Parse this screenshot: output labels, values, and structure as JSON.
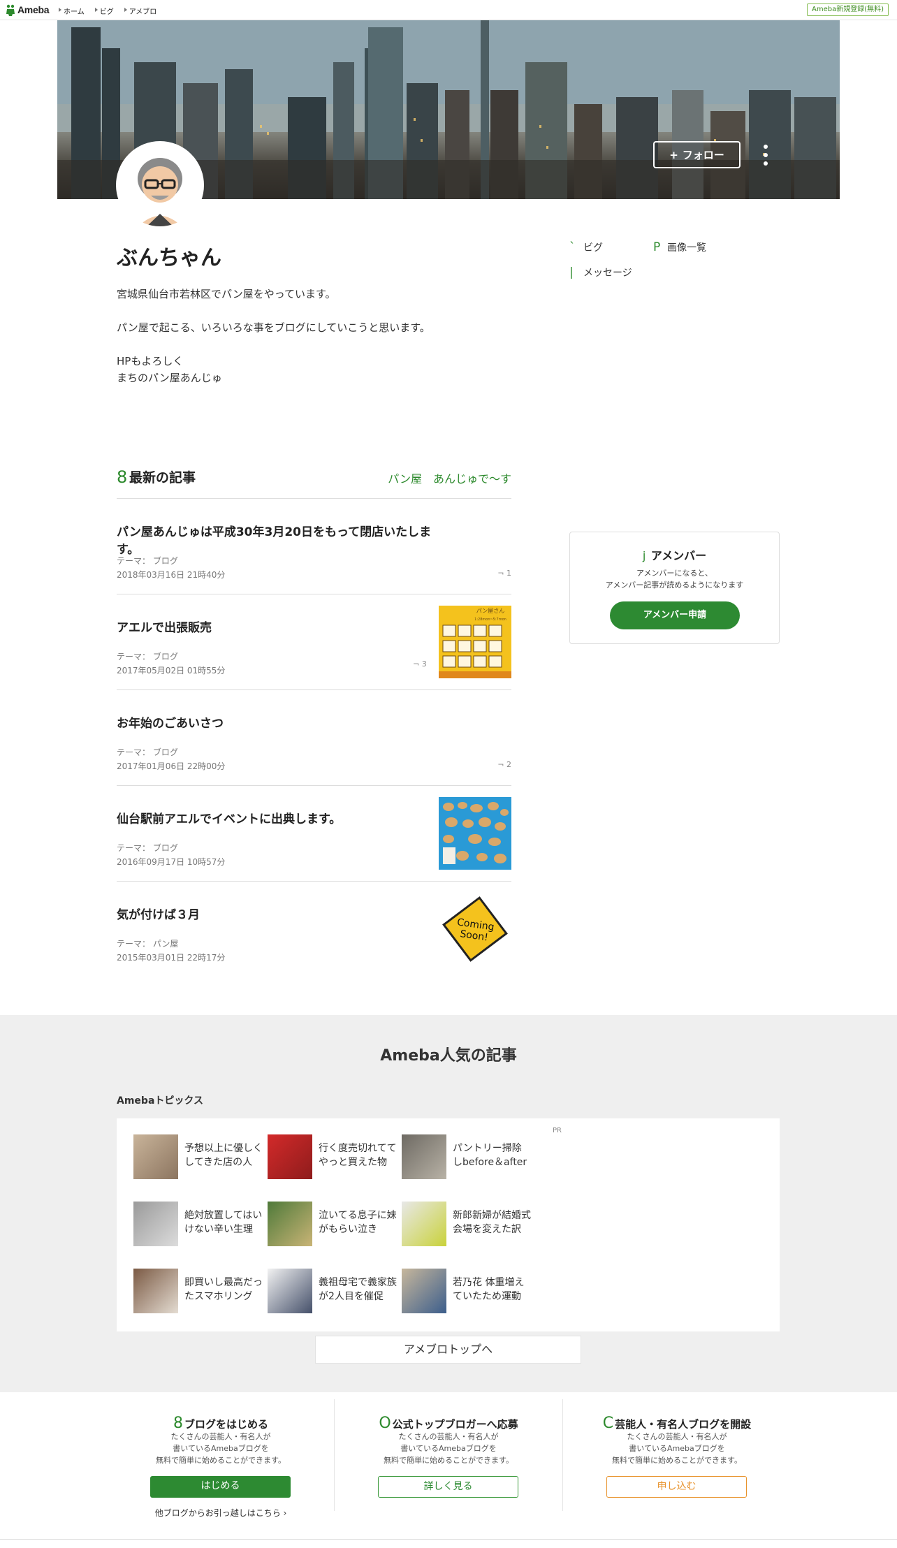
{
  "header": {
    "logo_text": "Ameba",
    "breadcrumbs": [
      "ホーム",
      "ビグ",
      "アメブロ"
    ],
    "register_label": "Ameba新規登録(無料)"
  },
  "profile": {
    "follow_label": "フォロー",
    "name": "ぶんちゃん",
    "bio": "宮城県仙台市若林区でパン屋をやっています。\n\nパン屋で起こる、いろいろな事をブログにしていこうと思います。\n\nHPもよろしく\nまちのパン屋あんじゅ",
    "links": [
      {
        "icon": "`",
        "label": "ビグ"
      },
      {
        "icon": "P",
        "label": "画像一覧"
      },
      {
        "icon": "|",
        "label": "メッセージ"
      }
    ]
  },
  "latest": {
    "icon": "8",
    "heading": "最新の記事",
    "blog_title": "パン屋　あんじゅで〜す",
    "entries": [
      {
        "title": "パン屋あんじゅは平成30年3月20日をもって閉店いたします。",
        "theme": "テーマ： ブログ",
        "date": "2018年03月16日 21時40分",
        "comments": "1"
      },
      {
        "title": "アエルで出張販売",
        "theme": "テーマ： ブログ",
        "date": "2017年05月02日 01時55分",
        "comments": "3"
      },
      {
        "title": "お年始のごあいさつ",
        "theme": "テーマ： ブログ",
        "date": "2017年01月06日 22時00分",
        "comments": "2"
      },
      {
        "title": "仙台駅前アエルでイベントに出典します。",
        "theme": "テーマ： ブログ",
        "date": "2016年09月17日 10時57分",
        "comments": ""
      },
      {
        "title": "気が付けば３月",
        "theme": "テーマ： パン屋",
        "date": "2015年03月01日 22時17分",
        "comments": ""
      }
    ],
    "comment_icon": "¬",
    "thumb2_lines": [
      "パン屋さん",
      "1:28mon~5:7mon"
    ],
    "sign_text": [
      "Coming",
      "Soon!"
    ]
  },
  "amember": {
    "icon": "j",
    "title": "アメンバー",
    "desc": "アメンバーになると、\nアメンバー記事が読めるようになります",
    "button": "アメンバー申請"
  },
  "popular": {
    "heading": "Ameba人気の記事",
    "topics_heading": "Amebaトピックス",
    "pr": "PR",
    "topics": [
      "予想以上に優しく\nしてきた店の人",
      "行く度売切れてて\nやっと買えた物",
      "パントリー掃除\nしbefore＆after",
      "絶対放置してはい\nけない辛い生理",
      "泣いてる息子に妹\nがもらい泣き",
      "新郎新婦が結婚式\n会場を変えた訳",
      "即買いし最高だっ\nたスマホリング",
      "義祖母宅で義家族\nが2人目を催促",
      "若乃花 体重増え\nていたため運動"
    ],
    "top_button": "アメブロトップへ"
  },
  "promos": [
    {
      "icon": "8",
      "title": "ブログをはじめる",
      "desc": "たくさんの芸能人・有名人が\n書いているAmebaブログを\n無料で簡単に始めることができます。",
      "button": "はじめる",
      "link": "他ブログからお引っ越しはこちら ›"
    },
    {
      "icon": "O",
      "title": "公式トップブロガーへ応募",
      "desc": "たくさんの芸能人・有名人が\n書いているAmebaブログを\n無料で簡単に始めることができます。",
      "button": "詳しく見る"
    },
    {
      "icon": "C",
      "title": "芸能人・有名人ブログを開設",
      "desc": "たくさんの芸能人・有名人が\n書いているAmebaブログを\n無料で簡単に始めることができます。",
      "button": "申し込む"
    }
  ],
  "colors": {
    "accent": "#2d8a32",
    "orange": "#e8932c",
    "section_bg": "#efefef"
  }
}
